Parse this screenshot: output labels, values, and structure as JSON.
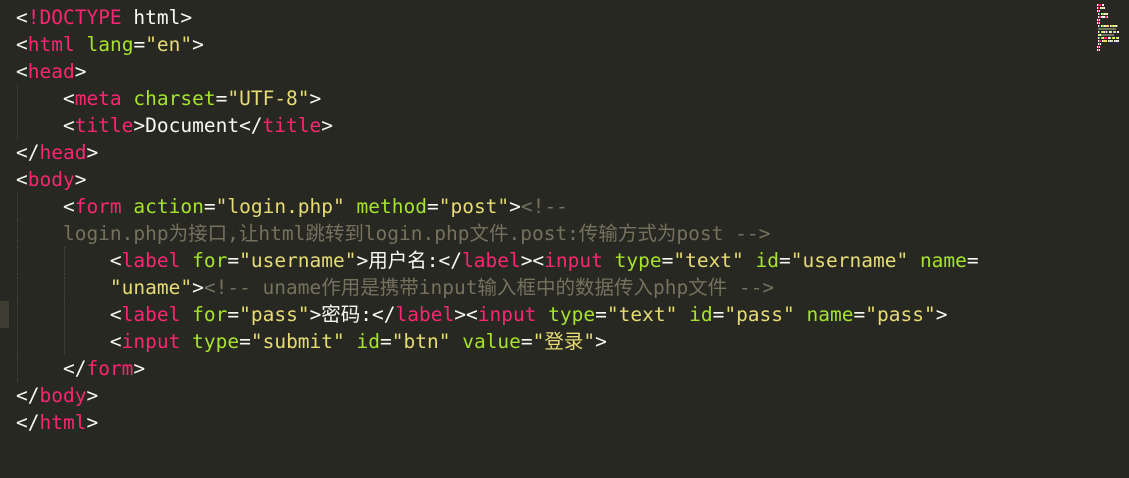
{
  "editor": {
    "theme_colors": {
      "background": "#272822",
      "tag": "#F92672",
      "attribute": "#A6E22E",
      "string": "#E6DB74",
      "text": "#F8F8F2",
      "comment": "#75715E"
    },
    "lines": [
      [
        {
          "k": "p",
          "v": "<"
        },
        {
          "k": "t",
          "v": "!DOCTYPE"
        },
        {
          "k": "p",
          "v": " html>"
        }
      ],
      [
        {
          "k": "p",
          "v": "<"
        },
        {
          "k": "t",
          "v": "html"
        },
        {
          "k": "p",
          "v": " "
        },
        {
          "k": "a",
          "v": "lang"
        },
        {
          "k": "p",
          "v": "="
        },
        {
          "k": "s",
          "v": "\"en\""
        },
        {
          "k": "p",
          "v": ">"
        }
      ],
      [
        {
          "k": "p",
          "v": "<"
        },
        {
          "k": "t",
          "v": "head"
        },
        {
          "k": "p",
          "v": ">"
        }
      ],
      [
        {
          "k": "p",
          "v": "    <"
        },
        {
          "k": "t",
          "v": "meta"
        },
        {
          "k": "p",
          "v": " "
        },
        {
          "k": "a",
          "v": "charset"
        },
        {
          "k": "p",
          "v": "="
        },
        {
          "k": "s",
          "v": "\"UTF-8\""
        },
        {
          "k": "p",
          "v": ">"
        }
      ],
      [
        {
          "k": "p",
          "v": "    <"
        },
        {
          "k": "t",
          "v": "title"
        },
        {
          "k": "p",
          "v": ">Document</"
        },
        {
          "k": "t",
          "v": "title"
        },
        {
          "k": "p",
          "v": ">"
        }
      ],
      [
        {
          "k": "p",
          "v": "</"
        },
        {
          "k": "t",
          "v": "head"
        },
        {
          "k": "p",
          "v": ">"
        }
      ],
      [
        {
          "k": "p",
          "v": "<"
        },
        {
          "k": "t",
          "v": "body"
        },
        {
          "k": "p",
          "v": ">"
        }
      ],
      [
        {
          "k": "p",
          "v": "    <"
        },
        {
          "k": "t",
          "v": "form"
        },
        {
          "k": "p",
          "v": " "
        },
        {
          "k": "a",
          "v": "action"
        },
        {
          "k": "p",
          "v": "="
        },
        {
          "k": "s",
          "v": "\"login.php\""
        },
        {
          "k": "p",
          "v": " "
        },
        {
          "k": "a",
          "v": "method"
        },
        {
          "k": "p",
          "v": "="
        },
        {
          "k": "s",
          "v": "\"post\""
        },
        {
          "k": "p",
          "v": ">"
        },
        {
          "k": "c",
          "v": "<!--"
        }
      ],
      [
        {
          "k": "c",
          "v": "    login.php为接口,让html跳转到login.php文件.post:传输方式为post -->"
        }
      ],
      [
        {
          "k": "p",
          "v": "        <"
        },
        {
          "k": "t",
          "v": "label"
        },
        {
          "k": "p",
          "v": " "
        },
        {
          "k": "a",
          "v": "for"
        },
        {
          "k": "p",
          "v": "="
        },
        {
          "k": "s",
          "v": "\"username\""
        },
        {
          "k": "p",
          "v": ">用户名:</"
        },
        {
          "k": "t",
          "v": "label"
        },
        {
          "k": "p",
          "v": "><"
        },
        {
          "k": "t",
          "v": "input"
        },
        {
          "k": "p",
          "v": " "
        },
        {
          "k": "a",
          "v": "type"
        },
        {
          "k": "p",
          "v": "="
        },
        {
          "k": "s",
          "v": "\"text\""
        },
        {
          "k": "p",
          "v": " "
        },
        {
          "k": "a",
          "v": "id"
        },
        {
          "k": "p",
          "v": "="
        },
        {
          "k": "s",
          "v": "\"username\""
        },
        {
          "k": "p",
          "v": " "
        },
        {
          "k": "a",
          "v": "name"
        },
        {
          "k": "p",
          "v": "="
        }
      ],
      [
        {
          "k": "s",
          "v": "        \"uname\""
        },
        {
          "k": "p",
          "v": ">"
        },
        {
          "k": "c",
          "v": "<!-- uname作用是携带input输入框中的数据传入php文件 -->"
        }
      ],
      [
        {
          "k": "p",
          "v": "        <"
        },
        {
          "k": "t",
          "v": "label"
        },
        {
          "k": "p",
          "v": " "
        },
        {
          "k": "a",
          "v": "for"
        },
        {
          "k": "p",
          "v": "="
        },
        {
          "k": "s",
          "v": "\"pass\""
        },
        {
          "k": "p",
          "v": ">密码:</"
        },
        {
          "k": "t",
          "v": "label"
        },
        {
          "k": "p",
          "v": "><"
        },
        {
          "k": "t",
          "v": "input"
        },
        {
          "k": "p",
          "v": " "
        },
        {
          "k": "a",
          "v": "type"
        },
        {
          "k": "p",
          "v": "="
        },
        {
          "k": "s",
          "v": "\"text\""
        },
        {
          "k": "p",
          "v": " "
        },
        {
          "k": "a",
          "v": "id"
        },
        {
          "k": "p",
          "v": "="
        },
        {
          "k": "s",
          "v": "\"pass\""
        },
        {
          "k": "p",
          "v": " "
        },
        {
          "k": "a",
          "v": "name"
        },
        {
          "k": "p",
          "v": "="
        },
        {
          "k": "s",
          "v": "\"pass\""
        },
        {
          "k": "p",
          "v": ">"
        }
      ],
      [
        {
          "k": "p",
          "v": "        <"
        },
        {
          "k": "t",
          "v": "input"
        },
        {
          "k": "p",
          "v": " "
        },
        {
          "k": "a",
          "v": "type"
        },
        {
          "k": "p",
          "v": "="
        },
        {
          "k": "s",
          "v": "\"submit\""
        },
        {
          "k": "p",
          "v": " "
        },
        {
          "k": "a",
          "v": "id"
        },
        {
          "k": "p",
          "v": "="
        },
        {
          "k": "s",
          "v": "\"btn\""
        },
        {
          "k": "p",
          "v": " "
        },
        {
          "k": "a",
          "v": "value"
        },
        {
          "k": "p",
          "v": "="
        },
        {
          "k": "s",
          "v": "\"登录\""
        },
        {
          "k": "p",
          "v": ">"
        }
      ],
      [
        {
          "k": "p",
          "v": "    </"
        },
        {
          "k": "t",
          "v": "form"
        },
        {
          "k": "p",
          "v": ">"
        }
      ],
      [
        {
          "k": "p",
          "v": "</"
        },
        {
          "k": "t",
          "v": "body"
        },
        {
          "k": "p",
          "v": ">"
        }
      ],
      [
        {
          "k": "p",
          "v": "</"
        },
        {
          "k": "t",
          "v": "html"
        },
        {
          "k": "p",
          "v": ">"
        }
      ]
    ],
    "current_line_index": 11
  }
}
